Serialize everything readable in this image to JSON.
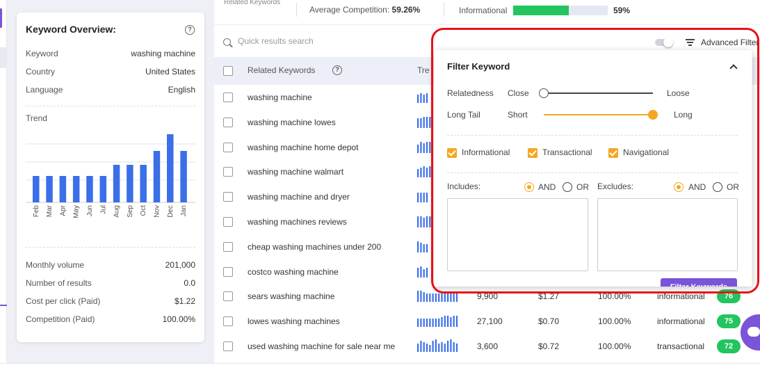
{
  "overview": {
    "title": "Keyword Overview:",
    "help": "?",
    "rows": [
      {
        "label": "Keyword",
        "value": "washing machine"
      },
      {
        "label": "Country",
        "value": "United States"
      },
      {
        "label": "Language",
        "value": "English"
      }
    ],
    "trend_label": "Trend",
    "stats": [
      {
        "label": "Monthly volume",
        "value": "201,000"
      },
      {
        "label": "Number of results",
        "value": "0.0"
      },
      {
        "label": "Cost per click (Paid)",
        "value": "$1.22"
      },
      {
        "label": "Competition (Paid)",
        "value": "100.00%"
      }
    ]
  },
  "chart_data": {
    "type": "bar",
    "categories": [
      "Feb",
      "Mar",
      "Apr",
      "May",
      "Jun",
      "Jul",
      "Aug",
      "Sep",
      "Oct",
      "Nov",
      "Dec",
      "Jan"
    ],
    "values": [
      38,
      38,
      38,
      38,
      38,
      38,
      54,
      54,
      54,
      74,
      98,
      74
    ],
    "ylim": [
      0,
      100
    ],
    "grid": true,
    "color": "#3b6fe8"
  },
  "topstats": {
    "related_keywords": "Related Keywords",
    "avg_comp_label": "Average Competition:",
    "avg_comp_value": "59.26%",
    "intent_label": "Informational",
    "intent_value": "59%",
    "intent_fraction": 0.59,
    "intent_color": "#22c55e"
  },
  "search": {
    "placeholder": "Quick results search"
  },
  "toolbar": {
    "advanced_filter": "Advanced Filter"
  },
  "table": {
    "header_label": "Related Keywords",
    "header_help": "?",
    "header_trend": "Tre",
    "rows": [
      {
        "keyword": "washing machine",
        "spark": [
          6,
          7,
          6,
          7
        ]
      },
      {
        "keyword": "washing machine lowes",
        "spark": [
          7,
          7,
          8,
          8,
          8
        ]
      },
      {
        "keyword": "washing machine home depot",
        "spark": [
          6,
          8,
          7,
          8,
          8
        ]
      },
      {
        "keyword": "washing machine walmart",
        "spark": [
          6,
          7,
          8,
          7,
          8
        ]
      },
      {
        "keyword": "washing machine and dryer",
        "spark": [
          7,
          7,
          7,
          7
        ]
      },
      {
        "keyword": "washing machines reviews",
        "spark": [
          8,
          8,
          7,
          8,
          8
        ]
      },
      {
        "keyword": "cheap washing machines under 200",
        "spark": [
          8,
          7,
          6,
          6
        ]
      },
      {
        "keyword": "costco washing machine",
        "spark": [
          7,
          8,
          6,
          7
        ]
      },
      {
        "keyword": "sears washing machine",
        "volume": "9,900",
        "cpc": "$1.27",
        "competition": "100.00%",
        "intent": "informational",
        "score": "76",
        "spark": [
          8,
          8,
          7,
          6,
          6,
          6,
          6,
          6,
          6,
          6,
          6,
          6,
          6,
          6
        ]
      },
      {
        "keyword": "lowes washing machines",
        "volume": "27,100",
        "cpc": "$0.70",
        "competition": "100.00%",
        "intent": "informational",
        "score": "75",
        "spark": [
          6,
          6,
          6,
          6,
          6,
          6,
          6,
          6,
          7,
          8,
          8,
          7,
          8,
          8
        ]
      },
      {
        "keyword": "used washing machine for sale near me",
        "volume": "3,600",
        "cpc": "$0.72",
        "competition": "100.00%",
        "intent": "transactional",
        "score": "72",
        "spark": [
          6,
          8,
          7,
          6,
          5,
          8,
          9,
          6,
          7,
          6,
          8,
          9,
          7,
          6
        ]
      }
    ]
  },
  "filter_popup": {
    "title": "Filter Keyword",
    "relatedness_label": "Relatedness",
    "relatedness_min": "Close",
    "relatedness_max": "Loose",
    "relatedness_value": 0.0,
    "longtail_label": "Long Tail",
    "longtail_min": "Short",
    "longtail_max": "Long",
    "longtail_value": 1.0,
    "intents": [
      "Informational",
      "Transactional",
      "Navigational"
    ],
    "includes_label": "Includes:",
    "excludes_label": "Excludes:",
    "and_label": "AND",
    "or_label": "OR",
    "button_label": "Filter Keywords",
    "accent": "#f5a623"
  }
}
